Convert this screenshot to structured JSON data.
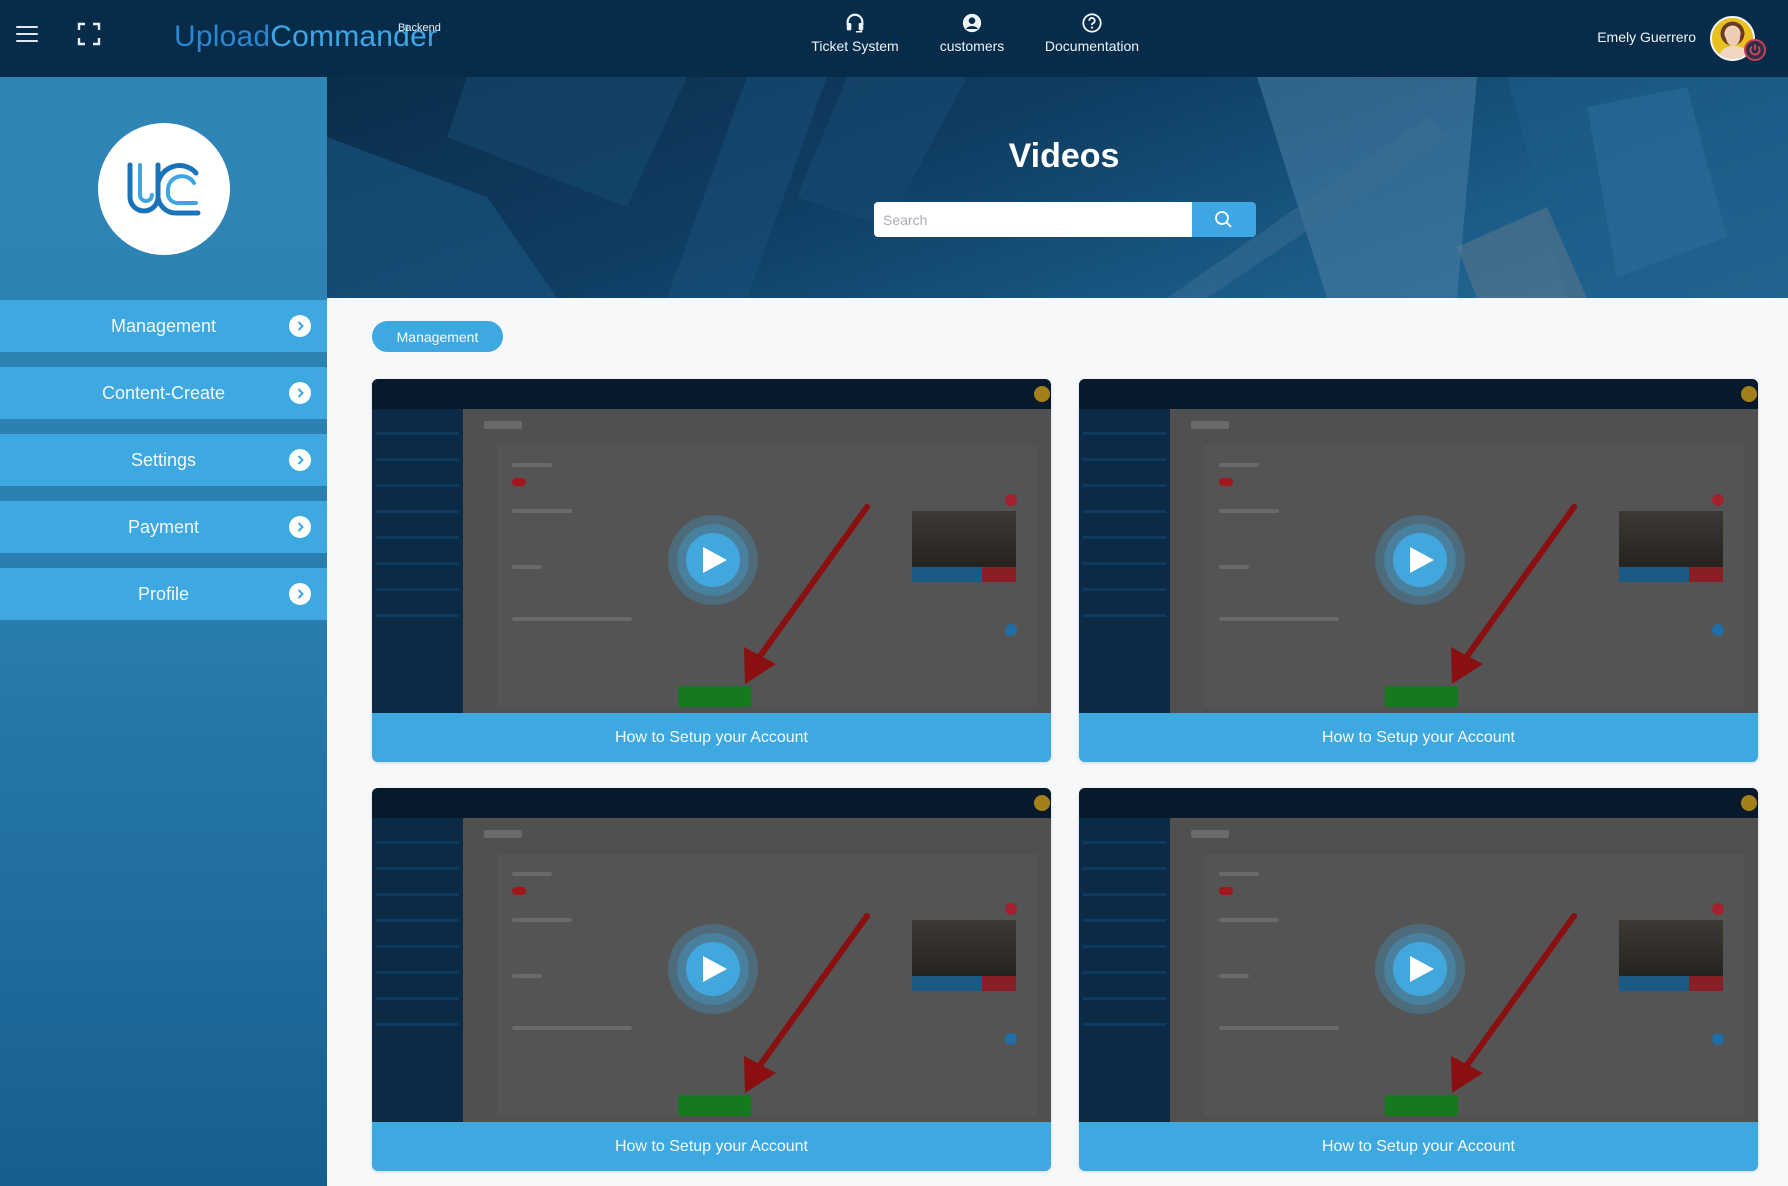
{
  "header": {
    "brand_upload": "Upload",
    "brand_commander": "Commander",
    "brand_badge": "Backend",
    "nav": [
      {
        "label": "Ticket System",
        "icon": "headset-icon"
      },
      {
        "label": "customers",
        "icon": "user-circle-icon"
      },
      {
        "label": "Documentation",
        "icon": "question-circle-icon"
      }
    ],
    "user_name": "Emely Guerrero"
  },
  "sidebar": {
    "logo_text": "UC",
    "items": [
      {
        "label": "Management"
      },
      {
        "label": "Content-Create"
      },
      {
        "label": "Settings"
      },
      {
        "label": "Payment"
      },
      {
        "label": "Profile"
      }
    ]
  },
  "hero": {
    "title": "Videos",
    "search_placeholder": "Search",
    "search_value": ""
  },
  "content": {
    "category_label": "Management",
    "videos": [
      {
        "title": "How to Setup your Account"
      },
      {
        "title": "How to Setup your Account"
      },
      {
        "title": "How to Setup your Account"
      },
      {
        "title": "How to Setup your Account"
      }
    ]
  },
  "colors": {
    "header_bg": "#062c4a",
    "accent": "#3ea9e0",
    "sidebar_top": "#2f86b6",
    "sidebar_bottom": "#175e90",
    "power_badge": "#c83f55"
  }
}
